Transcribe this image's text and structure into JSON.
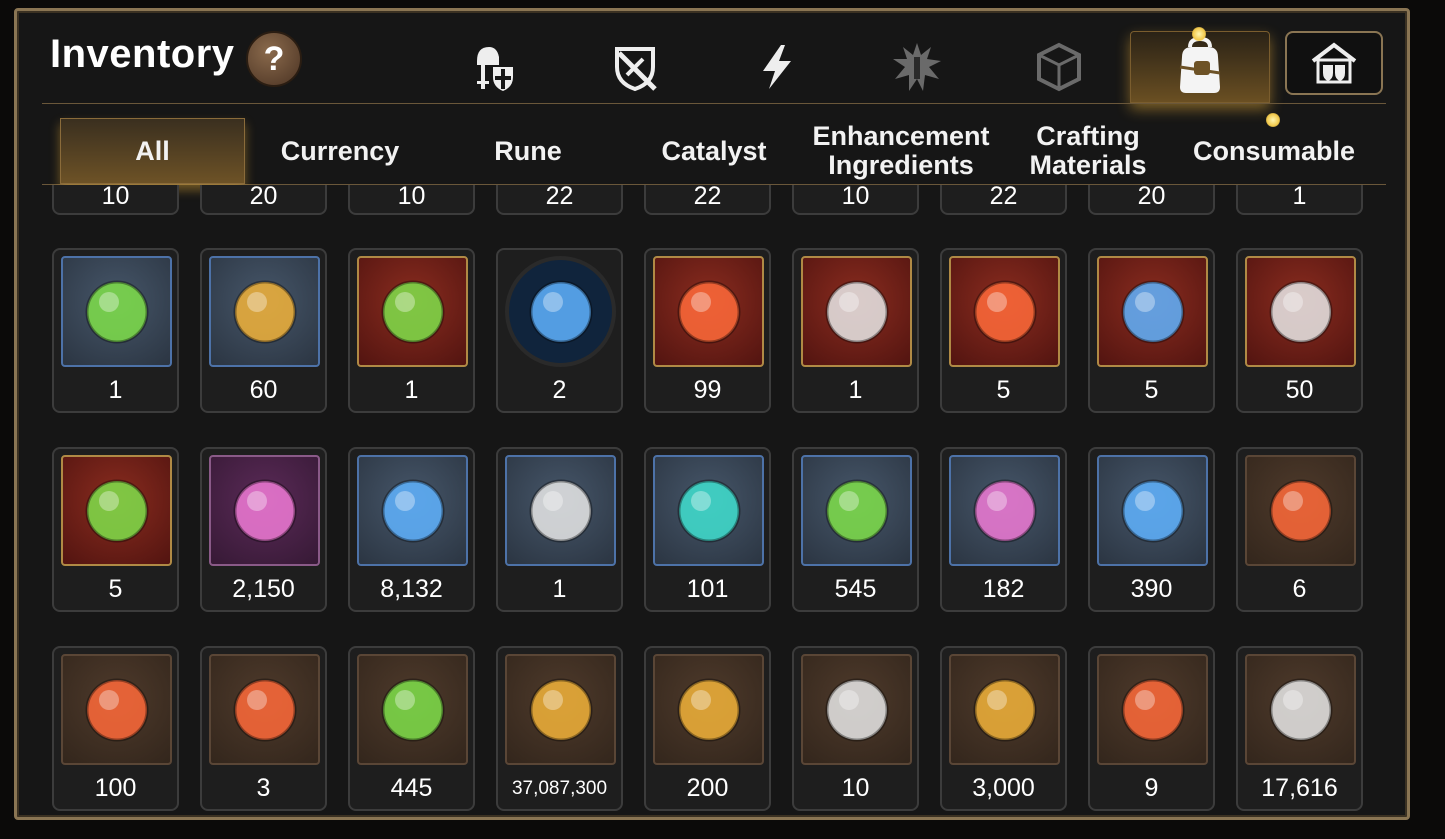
{
  "header": {
    "title": "Inventory",
    "help_label": "?",
    "top_icons": [
      {
        "name": "knight-shield-icon",
        "active": false
      },
      {
        "name": "crossed-shield-icon",
        "active": false
      },
      {
        "name": "lightning-icon",
        "active": false
      },
      {
        "name": "splatter-icon",
        "active": false
      },
      {
        "name": "broken-cube-icon",
        "active": false
      },
      {
        "name": "bag-icon",
        "active": true
      }
    ],
    "house_icon": "guild-house-icon"
  },
  "tabs": [
    {
      "label": "All",
      "active": true
    },
    {
      "label": "Currency",
      "active": false
    },
    {
      "label": "Rune",
      "active": false
    },
    {
      "label": "Catalyst",
      "active": false
    },
    {
      "label": "Enhancement\nIngredients",
      "active": false
    },
    {
      "label": "Crafting\nMaterials",
      "active": false
    },
    {
      "label": "Consumable",
      "active": false
    }
  ],
  "partial_row": [
    "10",
    "20",
    "10",
    "22",
    "22",
    "10",
    "22",
    "20",
    "1"
  ],
  "rows": [
    [
      {
        "icon": "slime-orbs-icon",
        "qty": "1",
        "frame": "blue"
      },
      {
        "icon": "ginseng-root-icon",
        "qty": "60",
        "frame": "blue"
      },
      {
        "icon": "green-pot-icon",
        "qty": "1",
        "frame": "red"
      },
      {
        "icon": "blue-rune-disc-icon",
        "qty": "2",
        "frame": "round"
      },
      {
        "icon": "orange-crystal-icon",
        "qty": "99",
        "frame": "red"
      },
      {
        "icon": "triquetra-pyramid-icon",
        "qty": "1",
        "frame": "red"
      },
      {
        "icon": "fire-pendant-icon",
        "qty": "5",
        "frame": "red"
      },
      {
        "icon": "water-pendant-icon",
        "qty": "5",
        "frame": "red"
      },
      {
        "icon": "dark-ring-pendant-icon",
        "qty": "50",
        "frame": "red"
      }
    ],
    [
      {
        "icon": "clover-pendant-icon",
        "qty": "5",
        "frame": "red"
      },
      {
        "icon": "crescent-flower-icon",
        "qty": "2,150",
        "frame": "purple"
      },
      {
        "icon": "blue-crystal-icon",
        "qty": "8,132",
        "frame": "blue"
      },
      {
        "icon": "pocket-watch-bookmark-icon",
        "qty": "1",
        "frame": "blue"
      },
      {
        "icon": "cyan-crystal-icon",
        "qty": "101",
        "frame": "blue"
      },
      {
        "icon": "glowing-leaf-icon",
        "qty": "545",
        "frame": "blue"
      },
      {
        "icon": "pink-gem-pile-icon",
        "qty": "182",
        "frame": "blue"
      },
      {
        "icon": "star-pendant-icon",
        "qty": "390",
        "frame": "blue"
      },
      {
        "icon": "lava-orb-icon",
        "qty": "6",
        "frame": "brown"
      }
    ],
    [
      {
        "icon": "red-bracelet-icon",
        "qty": "100",
        "frame": "brown"
      },
      {
        "icon": "red-badge-icon",
        "qty": "3",
        "frame": "brown"
      },
      {
        "icon": "green-heart-icon",
        "qty": "445",
        "frame": "brown"
      },
      {
        "icon": "gold-sun-coin-icon",
        "qty": "37,087,300",
        "frame": "brown",
        "small": true
      },
      {
        "icon": "gold-hexagon-emblem-icon",
        "qty": "200",
        "frame": "brown"
      },
      {
        "icon": "stone-compass-icon",
        "qty": "10",
        "frame": "brown"
      },
      {
        "icon": "gold-fist-emblem-icon",
        "qty": "3,000",
        "frame": "brown"
      },
      {
        "icon": "red-banner-icon",
        "qty": "9",
        "frame": "brown"
      },
      {
        "icon": "chess-knight-icon",
        "qty": "17,616",
        "frame": "brown"
      }
    ]
  ],
  "colors": {
    "frame_border": "#8a7553",
    "panel": "#161616",
    "active_glow": "#f2c94c"
  }
}
